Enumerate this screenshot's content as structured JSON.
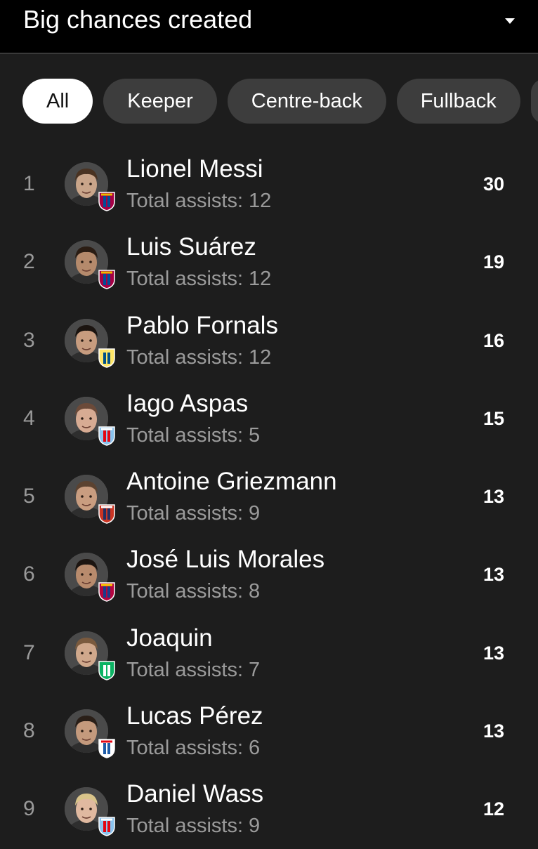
{
  "header": {
    "title": "Big chances created"
  },
  "filters": [
    {
      "label": "All",
      "active": true
    },
    {
      "label": "Keeper",
      "active": false
    },
    {
      "label": "Centre-back",
      "active": false
    },
    {
      "label": "Fullback",
      "active": false
    }
  ],
  "players": [
    {
      "rank": "1",
      "name": "Lionel Messi",
      "sub": "Total assists: 12",
      "value": "30",
      "skin": "#c9a58a",
      "hair": "#4a3322",
      "club_icon": "barcelona-crest-icon",
      "club_colors": [
        "#a50044",
        "#004d98",
        "#edbb00"
      ]
    },
    {
      "rank": "2",
      "name": "Luis Suárez",
      "sub": "Total assists: 12",
      "value": "19",
      "skin": "#b58a6c",
      "hair": "#2b1d14",
      "club_icon": "barcelona-crest-icon",
      "club_colors": [
        "#a50044",
        "#004d98",
        "#edbb00"
      ]
    },
    {
      "rank": "3",
      "name": "Pablo Fornals",
      "sub": "Total assists: 12",
      "value": "16",
      "skin": "#c79c7f",
      "hair": "#1b1410",
      "club_icon": "villarreal-crest-icon",
      "club_colors": [
        "#ffe667",
        "#005187",
        "#ffe667"
      ]
    },
    {
      "rank": "4",
      "name": "Iago Aspas",
      "sub": "Total assists: 5",
      "value": "15",
      "skin": "#d7ab93",
      "hair": "#6b4a39",
      "club_icon": "celta-crest-icon",
      "club_colors": [
        "#8ac3ee",
        "#e30613",
        "#ffffff"
      ]
    },
    {
      "rank": "5",
      "name": "Antoine Griezmann",
      "sub": "Total assists: 9",
      "value": "13",
      "skin": "#c99d80",
      "hair": "#5b4230",
      "club_icon": "atletico-crest-icon",
      "club_colors": [
        "#cb3524",
        "#262f61",
        "#ffffff"
      ]
    },
    {
      "rank": "6",
      "name": "José Luis Morales",
      "sub": "Total assists: 8",
      "value": "13",
      "skin": "#b88b6d",
      "hair": "#1c1511",
      "club_icon": "levante-crest-icon",
      "club_colors": [
        "#b4053f",
        "#1a3c8c",
        "#ffcc00"
      ]
    },
    {
      "rank": "7",
      "name": "Joaquin",
      "sub": "Total assists: 7",
      "value": "13",
      "skin": "#d0a88c",
      "hair": "#7a5a3e",
      "club_icon": "betis-crest-icon",
      "club_colors": [
        "#0bb363",
        "#ffffff",
        "#0bb363"
      ]
    },
    {
      "rank": "8",
      "name": "Lucas Pérez",
      "sub": "Total assists: 6",
      "value": "13",
      "skin": "#c49a7d",
      "hair": "#2a1f18",
      "club_icon": "deportivo-crest-icon",
      "club_colors": [
        "#ffffff",
        "#1e5ca8",
        "#e30613"
      ]
    },
    {
      "rank": "9",
      "name": "Daniel Wass",
      "sub": "Total assists: 9",
      "value": "12",
      "skin": "#e0b9a0",
      "hair": "#d9c48a",
      "club_icon": "celta-crest-icon",
      "club_colors": [
        "#8ac3ee",
        "#e30613",
        "#ffffff"
      ]
    }
  ]
}
